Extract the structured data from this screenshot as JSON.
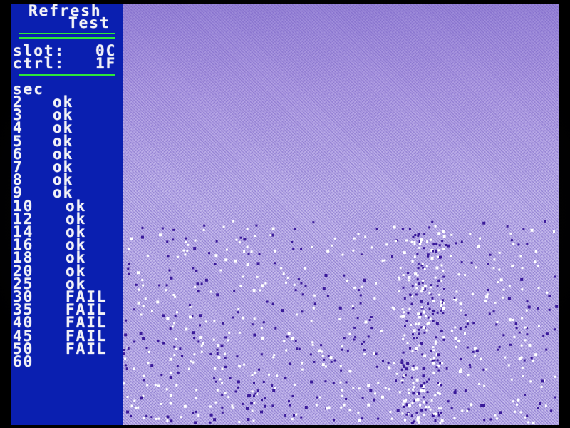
{
  "app": {
    "title_line1": "Refresh",
    "title_line2": "Test"
  },
  "status": {
    "slot_label": "slot:",
    "slot_value": "0C",
    "ctrl_label": "ctrl:",
    "ctrl_value": "1F"
  },
  "results": {
    "header": "sec",
    "rows": [
      {
        "sec": "2",
        "result": "ok"
      },
      {
        "sec": "3",
        "result": "ok"
      },
      {
        "sec": "4",
        "result": "ok"
      },
      {
        "sec": "5",
        "result": "ok"
      },
      {
        "sec": "6",
        "result": "ok"
      },
      {
        "sec": "7",
        "result": "ok"
      },
      {
        "sec": "8",
        "result": "ok"
      },
      {
        "sec": "9",
        "result": "ok"
      },
      {
        "sec": "10",
        "result": "ok"
      },
      {
        "sec": "12",
        "result": "ok"
      },
      {
        "sec": "14",
        "result": "ok"
      },
      {
        "sec": "16",
        "result": "ok"
      },
      {
        "sec": "18",
        "result": "ok"
      },
      {
        "sec": "20",
        "result": "ok"
      },
      {
        "sec": "25",
        "result": "ok"
      },
      {
        "sec": "30",
        "result": "FAIL"
      },
      {
        "sec": "35",
        "result": "FAIL"
      },
      {
        "sec": "40",
        "result": "FAIL"
      },
      {
        "sec": "45",
        "result": "FAIL"
      },
      {
        "sec": "50",
        "result": "FAIL"
      },
      {
        "sec": "60",
        "result": ""
      }
    ]
  },
  "colors": {
    "sidebar_bg": "#0a1fb0",
    "text": "#f2f2f6",
    "rule": "#2de83a",
    "pattern_bg": "#b6a8e6",
    "error_dark": "#3a1a9a",
    "error_light": "#ffffff"
  }
}
